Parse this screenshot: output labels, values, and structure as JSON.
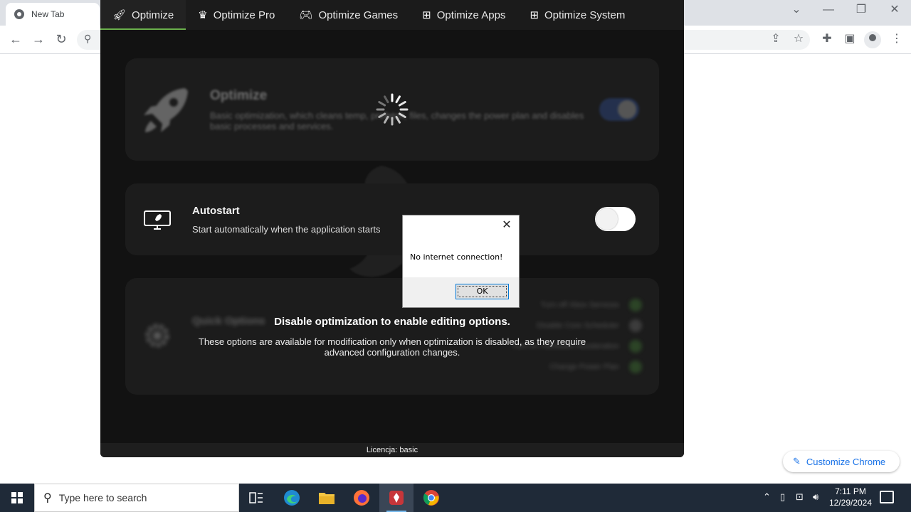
{
  "browser": {
    "tab_title": "New Tab",
    "customize_label": "Customize Chrome"
  },
  "app": {
    "nav": [
      {
        "label": "Optimize",
        "icon": "rocket-icon"
      },
      {
        "label": "Optimize Pro",
        "icon": "crown-icon"
      },
      {
        "label": "Optimize Games",
        "icon": "gamepad-icon"
      },
      {
        "label": "Optimize Apps",
        "icon": "apps-grid-icon"
      },
      {
        "label": "Optimize System",
        "icon": "windows-icon"
      }
    ],
    "optimize_card": {
      "title": "Optimize",
      "description": "Basic optimization, which cleans temp, prefetch, files, changes the power plan and disables basic processes and services."
    },
    "autostart_card": {
      "title": "Autostart",
      "description": "Start automatically when the application starts"
    },
    "quick_card": {
      "title": "Quick Options",
      "options": [
        "Turn off Xbox Services",
        "Disable Core Scheduler",
        "Turn on Hardware Acceleration",
        "Change Power Plan"
      ]
    },
    "overlay": {
      "title": "Disable optimization to enable editing options.",
      "description": "These options are available for modification only when optimization is disabled, as they require advanced configuration changes."
    },
    "footer": "Licencja: basic"
  },
  "dialog": {
    "message": "No internet connection!",
    "ok_label": "OK"
  },
  "taskbar": {
    "search_placeholder": "Type here to search",
    "time": "7:11 PM",
    "date": "12/29/2024"
  },
  "colors": {
    "app_bg": "#121212",
    "card_bg": "#1c1c1c",
    "accent_green": "#6ab04c",
    "toggle_blue": "#2f4a8a",
    "taskbar_bg": "#1f2a38"
  }
}
